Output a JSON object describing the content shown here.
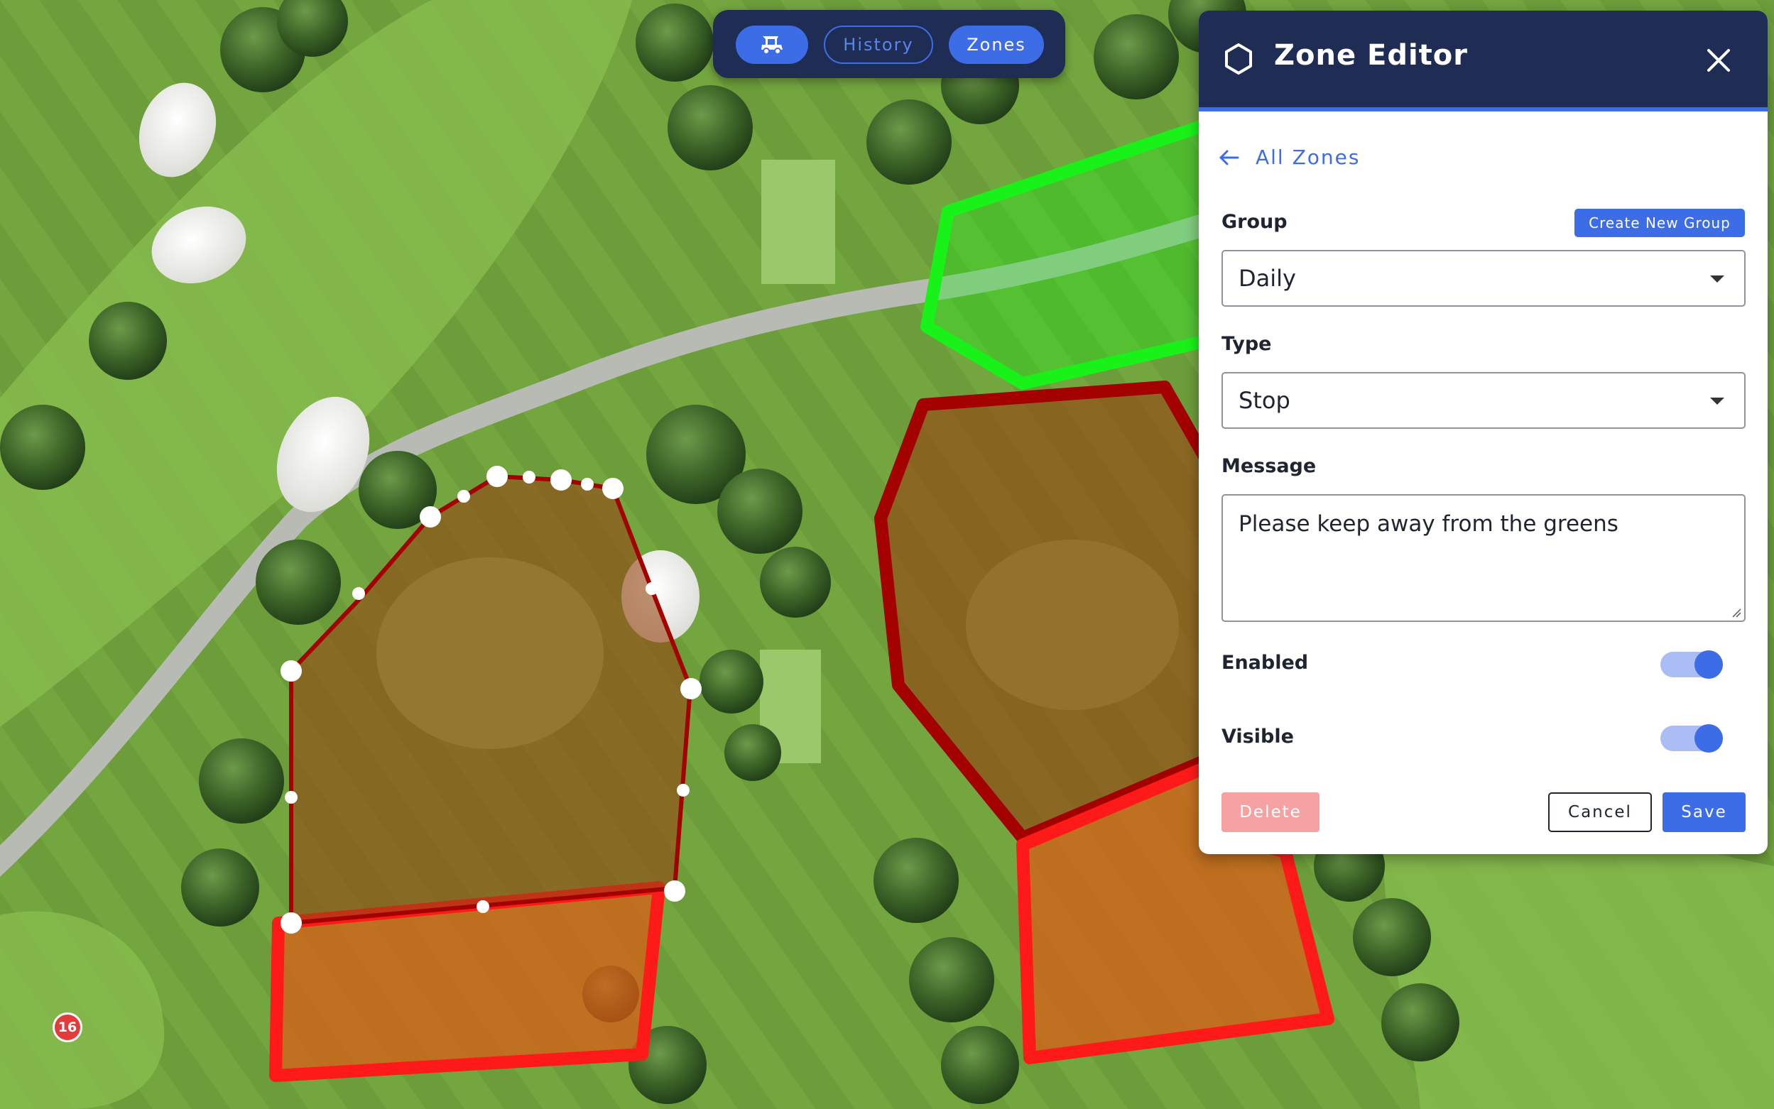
{
  "toolbar": {
    "cart_icon": "golf-cart-icon",
    "history_label": "History",
    "zones_label": "Zones"
  },
  "map": {
    "hole_number": "16"
  },
  "zone_editor": {
    "title": "Zone Editor",
    "title_icon": "hexagon-icon",
    "close_icon": "close-icon",
    "back_label": "All Zones",
    "group_label": "Group",
    "create_group_label": "Create New Group",
    "group_value": "Daily",
    "type_label": "Type",
    "type_value": "Stop",
    "message_label": "Message",
    "message_value": "Please keep away from the greens",
    "enabled_label": "Enabled",
    "enabled": true,
    "visible_label": "Visible",
    "visible": true,
    "delete_label": "Delete",
    "cancel_label": "Cancel",
    "save_label": "Save"
  },
  "colors": {
    "accent": "#3d6ce7",
    "header_bg": "#1f2d55",
    "zone_stop_dark": "#a30000",
    "zone_stop_bright": "#ff1a1a",
    "zone_green": "#19f219",
    "delete_bg": "#f6a2a2"
  }
}
